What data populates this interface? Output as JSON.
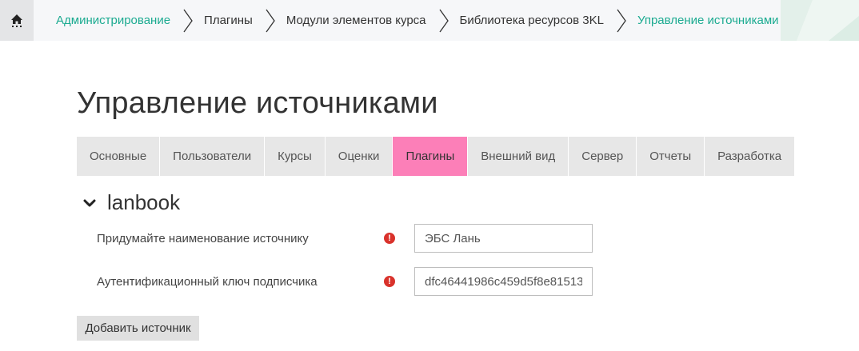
{
  "breadcrumb": {
    "home_icon": "home-icon",
    "items": [
      {
        "label": "Администрирование",
        "link": true
      },
      {
        "label": "Плагины",
        "link": false
      },
      {
        "label": "Модули элементов курса",
        "link": false
      },
      {
        "label": "Библиотека ресурсов 3KL",
        "link": false
      },
      {
        "label": "Управление источниками",
        "link": true
      }
    ]
  },
  "page": {
    "title": "Управление источниками"
  },
  "tabs": [
    {
      "label": "Основные"
    },
    {
      "label": "Пользователи"
    },
    {
      "label": "Курсы"
    },
    {
      "label": "Оценки"
    },
    {
      "label": "Плагины",
      "active": true
    },
    {
      "label": "Внешний вид"
    },
    {
      "label": "Сервер"
    },
    {
      "label": "Отчеты"
    },
    {
      "label": "Разработка"
    }
  ],
  "section": {
    "title": "lanbook",
    "fields": [
      {
        "label": "Придумайте наименование источнику",
        "value": "ЭБС Лань",
        "required_icon": "!"
      },
      {
        "label": "Аутентификационный ключ подписчика",
        "value": "dfc46441986c459d5f8e81513",
        "required_icon": "!"
      }
    ]
  },
  "actions": {
    "add_source_label": "Добавить источник"
  },
  "colors": {
    "link": "#1cab91",
    "active_tab": "#fc7fb8",
    "required": "#d9322b"
  }
}
